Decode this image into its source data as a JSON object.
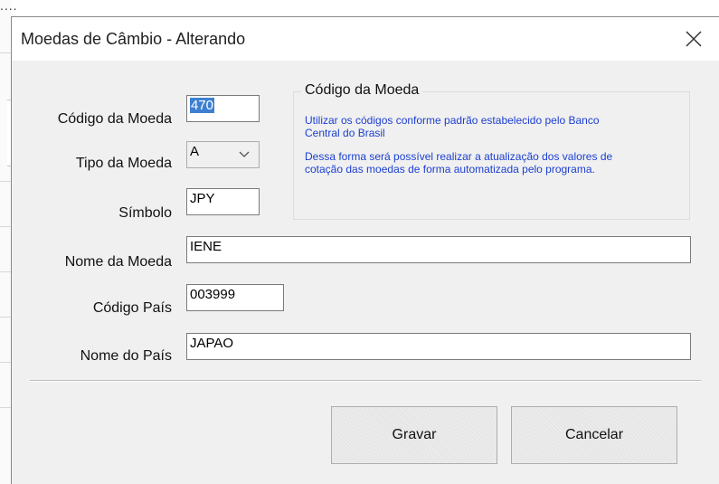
{
  "window": {
    "title": "Moedas de Câmbio - Alterando"
  },
  "background": {
    "dots": "...."
  },
  "form": {
    "codigo_moeda": {
      "label": "Código da Moeda",
      "value": "470"
    },
    "tipo_moeda": {
      "label": "Tipo da Moeda",
      "value": "A"
    },
    "simbolo": {
      "label": "Símbolo",
      "value": "JPY"
    },
    "nome_moeda": {
      "label": "Nome da Moeda",
      "value": "IENE"
    },
    "codigo_pais": {
      "label": "Código País",
      "value": "003999"
    },
    "nome_pais": {
      "label": "Nome do País",
      "value": "JAPAO"
    }
  },
  "info": {
    "title": "Código da Moeda",
    "line1": "Utilizar os códigos conforme padrão estabelecido pelo Banco",
    "line2": "Central do Brasil",
    "line3": "Dessa forma será possível realizar a atualização dos valores de",
    "line4": "cotação das moedas de forma automatizada pelo programa.",
    "text_color": "#1c3fd1"
  },
  "buttons": {
    "save": "Gravar",
    "cancel": "Cancelar"
  },
  "icons": {
    "close": "close-icon",
    "dropdown": "chevron-down-icon"
  }
}
